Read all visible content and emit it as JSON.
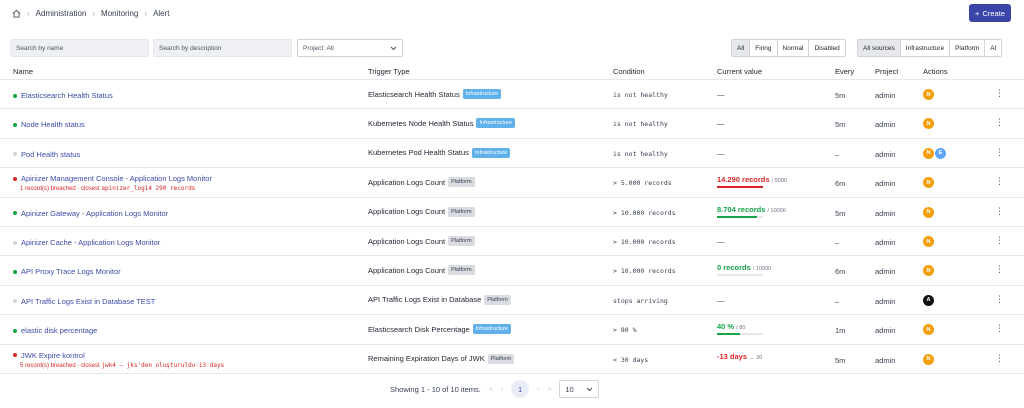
{
  "breadcrumb": [
    "Administration",
    "Monitoring",
    "Alert"
  ],
  "create_label": "Create",
  "filters": {
    "search_name_placeholder": "Search by name",
    "search_desc_placeholder": "Search by description",
    "project_select": "Project: All",
    "status_tabs": [
      "All",
      "Firing",
      "Normal",
      "Disabled"
    ],
    "status_active": "All",
    "source_tabs": [
      "All sources",
      "Infrastructure",
      "Platform",
      "AI"
    ],
    "source_active": "All sources"
  },
  "columns": [
    "Name",
    "Trigger Type",
    "Condition",
    "Current value",
    "Every",
    "Project",
    "Actions"
  ],
  "rows": [
    {
      "name": "Elasticsearch Health Status",
      "status": "green",
      "trigger": "Elasticsearch Health Status",
      "badge": "Infrastructure",
      "condition": "is not healthy",
      "current": "—",
      "every": "5m",
      "project": "admin",
      "avatars": [
        "N"
      ]
    },
    {
      "name": "Node Health status",
      "status": "green",
      "trigger": "Kubernetes Node Health Status",
      "badge": "Infrastructure",
      "condition": "is not healthy",
      "current": "—",
      "every": "5m",
      "project": "admin",
      "avatars": [
        "N"
      ]
    },
    {
      "name": "Pod Health status",
      "status": "gray",
      "trigger": "Kubernetes Pod Health Status",
      "badge": "Infrastructure",
      "condition": "is not healthy",
      "current": "—",
      "every": "–",
      "project": "admin",
      "avatars": [
        "N",
        "E"
      ]
    },
    {
      "name": "Apinizer Management Console - Application Logs Monitor",
      "status": "red",
      "breach_text": "1 record(s) breached · closest",
      "breach_code": "apinizer_log14 290 records",
      "trigger": "Application Logs Count",
      "badge": "Platform",
      "condition": "> 5.000 records",
      "current": "14.290 records",
      "current_sub": "/ 5000",
      "current_color": "#dc2626",
      "progress": 1.0,
      "every": "6m",
      "project": "admin",
      "avatars": [
        "N"
      ]
    },
    {
      "name": "Apinizer Gateway - Application Logs Monitor",
      "status": "green",
      "trigger": "Application Logs Count",
      "badge": "Platform",
      "condition": "> 10.000 records",
      "current": "8.704 records",
      "current_sub": "/ 10000",
      "current_color": "#16a34a",
      "progress": 0.87,
      "every": "5m",
      "project": "admin",
      "avatars": [
        "N"
      ]
    },
    {
      "name": "Apinizer Cache - Application Logs Monitor",
      "status": "gray",
      "trigger": "Application Logs Count",
      "badge": "Platform",
      "condition": "> 10.000 records",
      "current": "—",
      "every": "–",
      "project": "admin",
      "avatars": [
        "N"
      ]
    },
    {
      "name": "API Proxy Trace Logs Monitor",
      "status": "green",
      "trigger": "Application Logs Count",
      "badge": "Platform",
      "condition": "> 10.000 records",
      "current": "0 records",
      "current_sub": "/ 10000",
      "current_color": "#16a34a",
      "progress": 0.0,
      "every": "6m",
      "project": "admin",
      "avatars": [
        "N"
      ]
    },
    {
      "name": "API Traffic Logs Exist in Database TEST",
      "status": "gray",
      "trigger": "API Traffic Logs Exist in Database",
      "badge": "Platform",
      "condition": "stops arriving",
      "current": "—",
      "every": "–",
      "project": "admin",
      "avatars": [
        "A"
      ]
    },
    {
      "name": "elastic disk percentage",
      "status": "green",
      "trigger": "Elasticsearch Disk Percentage",
      "badge": "Infrastructure",
      "condition": "> 80 %",
      "current": "40 %",
      "current_sub": "/ 80",
      "current_color": "#16a34a",
      "progress": 0.5,
      "every": "1m",
      "project": "admin",
      "avatars": [
        "N"
      ]
    },
    {
      "name": "JWK Expire kontrol",
      "status": "red",
      "breach_text": "5 record(s) breached · closest",
      "breach_code": "jwk4 – jks'den oluşturuldu·13 days",
      "trigger": "Remaining Expiration Days of JWK",
      "badge": "Platform",
      "condition": "< 30 days",
      "current": "-13 days",
      "current_sub": "→ 30",
      "current_color": "#dc2626",
      "every": "5m",
      "project": "admin",
      "avatars": [
        "N"
      ]
    }
  ],
  "pagination": {
    "summary": "Showing 1 - 10 of 10 items.",
    "current_page": "1",
    "page_size": "10"
  },
  "colors": {
    "primary": "#3b45a8",
    "link": "#3b4aa8",
    "green": "#16a34a",
    "red": "#dc2626",
    "avatar_orange": "#f59e0b",
    "avatar_blue": "#60a5fa",
    "avatar_black": "#111111"
  }
}
